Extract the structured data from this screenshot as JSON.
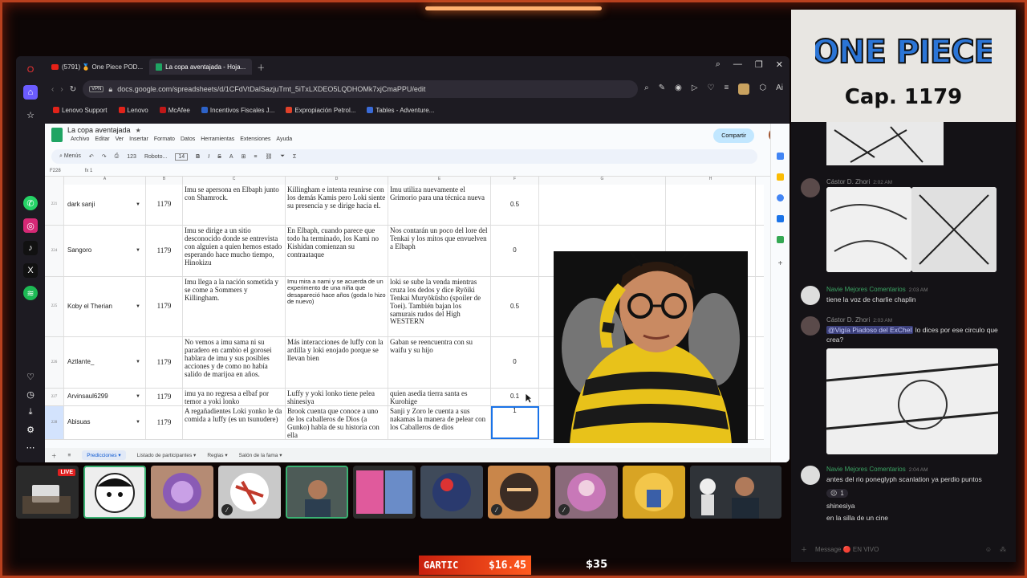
{
  "browser": {
    "tabs": [
      {
        "label": "(5791) 🏅 One Piece POD..."
      },
      {
        "label": "La copa aventajada - Hoja..."
      }
    ],
    "url": "docs.google.com/spreadsheets/d/1CFdVtDalSazjuTmt_5iTxLXDEO5LQDHOMk7xjCmaPPU/edit",
    "vpn": "VPN",
    "ai_label": "Ai",
    "bookmarks": [
      "Lenovo Support",
      "Lenovo",
      "McAfee",
      "Incentivos Fiscales J...",
      "Expropiación Petrol...",
      "Tables - Adventure..."
    ]
  },
  "sheet": {
    "title": "La copa aventajada",
    "menus": [
      "Archivo",
      "Editar",
      "Ver",
      "Insertar",
      "Formato",
      "Datos",
      "Herramientas",
      "Extensiones",
      "Ayuda"
    ],
    "share": "Compartir",
    "toolbar": {
      "search": "Menús",
      "font": "Roboto...",
      "size": "14",
      "zoom": "123"
    },
    "cell_ref": "F228",
    "formula": "1",
    "columns": [
      "A",
      "B",
      "C",
      "D",
      "E",
      "F",
      "G",
      "H"
    ],
    "rows": [
      {
        "num": "221",
        "name": "dark sanji",
        "cap": "1179",
        "d": "Imu se apersona en Elbaph junto con Shamrock.",
        "e": "Killingham e intenta reunirse con los demás Kamis pero Loki siente su presencia  y se dirige hacia el.",
        "f": "Imu utiliza nuevamente el Grimorio para una técnica nueva",
        "g": "0.5"
      },
      {
        "num": "224",
        "name": "Sangoro",
        "cap": "1179",
        "d": "Imu se dirige a un sitio desconocido donde se entrevista con alguien a quien hemos estado esperando hace mucho tiempo, Hinokizu",
        "e": "En Elbaph, cuando parece que todo ha terminado, los Kami no Kishidan comienzan su contraataque",
        "f": "Nos contarán un poco del lore del Tenkai y los mitos que envuelven a Elbaph",
        "g": "0"
      },
      {
        "num": "225",
        "name": "Koby el Therian",
        "cap": "1179",
        "d": " Imu llega a la nación sometida y se come a Sommers y Killingham.",
        "e": " Imu mira a nami y se acuerda de un experimento de una niña que desapareció hace años (goda lo hizo de nuevo)",
        "f": "loki se sube la venda mientras cruza los dedos y dice Ryōiki Tenkai Muryōkūsho (spoiler de Toei). También bajan los samurais rudos del High WESTERN",
        "g": "0.5"
      },
      {
        "num": "226",
        "name": "Aztlante_",
        "cap": "1179",
        "d": "No vemos a imu sama ni su paradero en cambio el gorosei hablara de imu y sus posibles acciones y de como no había salido de marijoa en años.",
        "e": "Más interacciones de luffy con la ardilla y loki enojado porque se llevan bien",
        "f": "Gaban se reencuentra con su waifu y su hijo",
        "g": "0"
      },
      {
        "num": "227",
        "name": "Arvinsaul6299",
        "cap": "1179",
        "d": "imu ya no regresa a elbaf por temor a yoki lonko",
        "e": " Luffy y yoki lonko tiene pelea shinesiya",
        "f": "quien asedia tierra santa es Kurohige",
        "g": "0.1"
      },
      {
        "num": "228",
        "name": "Abisuas",
        "cap": "1179",
        "d": "A regañadientes Loki yonko le da comida a luffy (es un tsunudere)",
        "e": "Brook cuenta que conoce a uno de los caballeros de Dios (a Gunko) habla de su historia  con ella",
        "f": "Sanji y Zoro le cuenta a sus nakamas la manera de pelear con los Caballeros de dios",
        "g": "1"
      }
    ],
    "sheet_tabs": [
      "Predicciones",
      "Listado de participantes",
      "Reglas",
      "Salón de la fama"
    ]
  },
  "bottom_bar": {
    "gartic_label": "GARTIC",
    "gartic_value": "$16.45",
    "second_value": "$35"
  },
  "live_badge": "LIVE",
  "right_panel": {
    "logo_text": "ONE PIECE",
    "chapter": "Cap. 1179",
    "messages": [
      {
        "name": "Cástor D. Zhori",
        "time": "2:02 AM",
        "text": ""
      },
      {
        "name": "Navie Mejores Comentarios",
        "time": "2:03 AM",
        "text": "tiene la voz de charlie chaplin"
      },
      {
        "name": "Cástor D. Zhori",
        "time": "2:03 AM",
        "mention": "@Vigía Piadoso del ExChel",
        "text": " lo dices por ese circulo que crea?"
      },
      {
        "name": "Navie Mejores Comentarios",
        "time": "2:04 AM",
        "text": "antes del rio poneglyph scanlation ya perdio puntos",
        "reaction_count": "1",
        "extra1": "shinesiya",
        "extra2": "en la silla de un cine"
      }
    ],
    "input_placeholder": "Message 🔴 EN VIVO"
  }
}
